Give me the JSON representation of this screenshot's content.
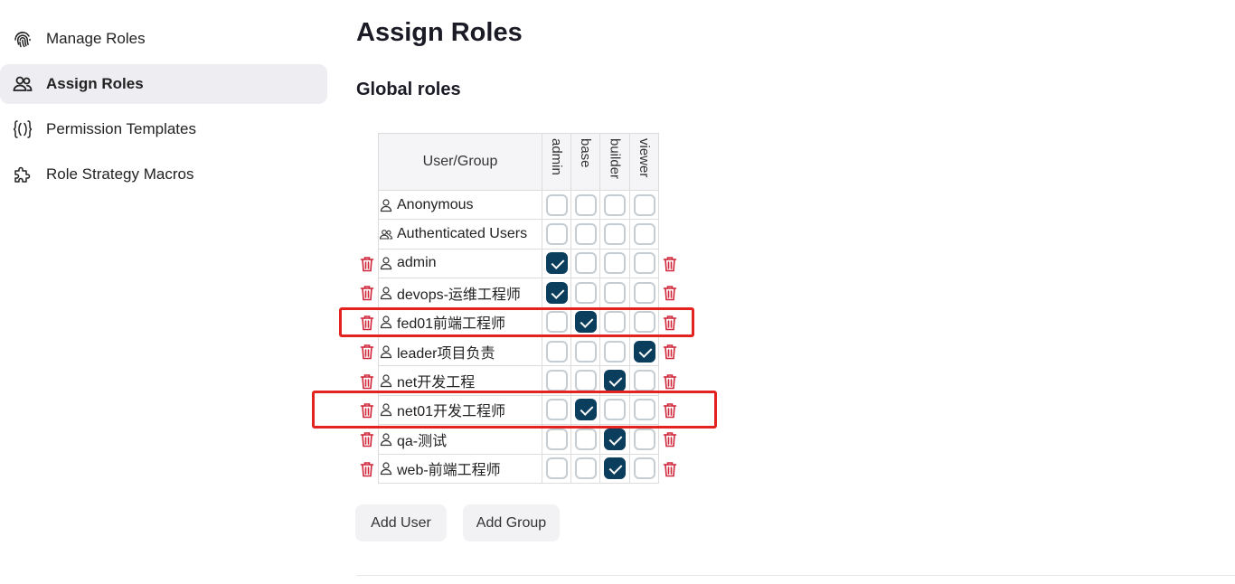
{
  "sidebar": {
    "items": [
      {
        "label": "Manage Roles",
        "icon": "fingerprint-icon",
        "active": false
      },
      {
        "label": "Assign Roles",
        "icon": "users-icon",
        "active": true
      },
      {
        "label": "Permission Templates",
        "icon": "braces-icon",
        "active": false
      },
      {
        "label": "Role Strategy Macros",
        "icon": "puzzle-icon",
        "active": false
      }
    ]
  },
  "main": {
    "title": "Assign Roles",
    "section_title": "Global roles",
    "table": {
      "user_header": "User/Group",
      "roles": [
        "admin",
        "base",
        "builder",
        "viewer"
      ],
      "rows": [
        {
          "name": "Anonymous",
          "icon": "user-icon",
          "checks": [
            false,
            false,
            false,
            false
          ],
          "deletable": false
        },
        {
          "name": "Authenticated Users",
          "icon": "group-icon",
          "checks": [
            false,
            false,
            false,
            false
          ],
          "deletable": false
        },
        {
          "name": "admin",
          "icon": "user-icon",
          "checks": [
            true,
            false,
            false,
            false
          ],
          "deletable": true
        },
        {
          "name": "devops-运维工程师",
          "icon": "user-icon",
          "checks": [
            true,
            false,
            false,
            false
          ],
          "deletable": true
        },
        {
          "name": "fed01前端工程师",
          "icon": "user-icon",
          "checks": [
            false,
            true,
            false,
            false
          ],
          "deletable": true
        },
        {
          "name": "leader项目负责",
          "icon": "user-icon",
          "checks": [
            false,
            false,
            false,
            true
          ],
          "deletable": true
        },
        {
          "name": "net开发工程",
          "icon": "user-icon",
          "checks": [
            false,
            false,
            true,
            false
          ],
          "deletable": true
        },
        {
          "name": "net01开发工程师",
          "icon": "user-icon",
          "checks": [
            false,
            true,
            false,
            false
          ],
          "deletable": true
        },
        {
          "name": "qa-测试",
          "icon": "user-icon",
          "checks": [
            false,
            false,
            true,
            false
          ],
          "deletable": true
        },
        {
          "name": "web-前端工程师",
          "icon": "user-icon",
          "checks": [
            false,
            false,
            true,
            false
          ],
          "deletable": true
        }
      ]
    },
    "buttons": {
      "add_user": "Add User",
      "add_group": "Add Group"
    },
    "colors": {
      "checked": "#0b3d5c",
      "delete": "#d0263a",
      "highlight": "#e3231f"
    }
  }
}
